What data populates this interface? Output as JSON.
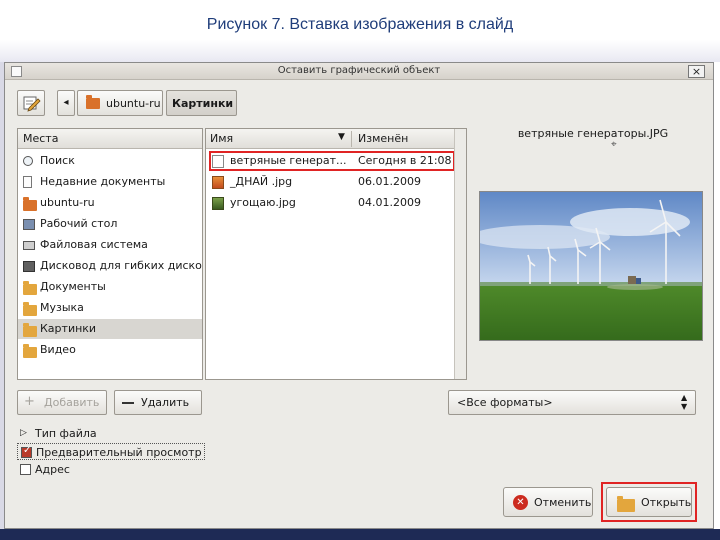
{
  "slide": {
    "title": "Рисунок 7. Вставка изображения в слайд"
  },
  "dialog": {
    "title": "Оставить графический объект",
    "close_glyph": "×"
  },
  "breadcrumbs": {
    "back_glyph": "◂",
    "items": [
      {
        "label": "ubuntu-ru",
        "icon": "home-folder-icon"
      },
      {
        "label": "Картинки",
        "icon": "none"
      }
    ]
  },
  "places": {
    "header": "Места",
    "items": [
      {
        "label": "Поиск",
        "icon": "search-icon"
      },
      {
        "label": "Недавние документы",
        "icon": "recent-documents-icon"
      },
      {
        "label": "ubuntu-ru",
        "icon": "home-folder-icon"
      },
      {
        "label": "Рабочий стол",
        "icon": "desktop-icon"
      },
      {
        "label": "Файловая система",
        "icon": "filesystem-icon"
      },
      {
        "label": "Дисковод для гибких диско",
        "icon": "floppy-icon"
      },
      {
        "label": "Документы",
        "icon": "folder-icon"
      },
      {
        "label": "Музыка",
        "icon": "folder-icon"
      },
      {
        "label": "Картинки",
        "icon": "folder-icon"
      },
      {
        "label": "Видео",
        "icon": "folder-icon"
      }
    ],
    "selected_index": 8
  },
  "files": {
    "columns": {
      "name": "Имя",
      "sort_glyph": "▼",
      "modified": "Изменён"
    },
    "rows": [
      {
        "name": "ветряные генерат...",
        "date": "Сегодня в 21:08",
        "icon": "blank-file-icon"
      },
      {
        "name": "_ДНАЙ .jpg",
        "date": "06.01.2009",
        "icon": "image-file-icon"
      },
      {
        "name": "угощаю.jpg",
        "date": "04.01.2009",
        "icon": "image-file-icon"
      }
    ]
  },
  "preview": {
    "filename": "ветряные генераторы.JPG"
  },
  "place_buttons": {
    "add": {
      "glyph": "+",
      "label": "Добавить"
    },
    "remove": {
      "label": "Удалить"
    }
  },
  "filter": {
    "selected": "<Все форматы>",
    "arrow_glyphs": "▲▼"
  },
  "options": {
    "file_type": "Тип файла",
    "preview": "Предварительный просмотр",
    "address": "Адрес",
    "preview_checked": true,
    "address_checked": false
  },
  "buttons": {
    "cancel": "Отменить",
    "cancel_glyph": "✕",
    "open": "Открыть"
  },
  "colors": {
    "highlight": "#e02424",
    "title_text": "#1f3d7a"
  }
}
